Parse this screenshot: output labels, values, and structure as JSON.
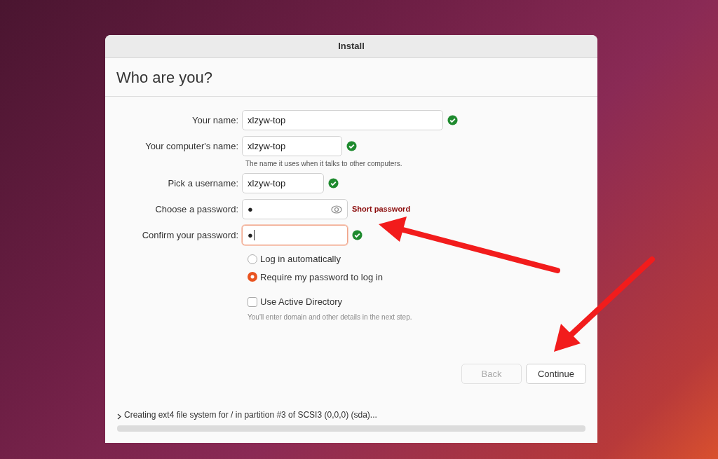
{
  "window": {
    "title": "Install"
  },
  "heading": "Who are you?",
  "fields": [
    {
      "label": "Your name:",
      "value": "xlzyw-top",
      "valid": true,
      "focused": false
    },
    {
      "label": "Your computer's name:",
      "value": "xlzyw-top",
      "valid": true,
      "focused": false,
      "hint": "The name it uses when it talks to other computers."
    },
    {
      "label": "Pick a username:",
      "value": "xlzyw-top",
      "valid": true,
      "focused": false
    },
    {
      "label": "Choose a password:",
      "value": "●",
      "valid": false,
      "focused": false,
      "reveal_icon": true,
      "message": "Short password"
    },
    {
      "label": "Confirm your password:",
      "value": "●",
      "valid": true,
      "focused": true
    }
  ],
  "login_options": [
    {
      "label": "Log in automatically",
      "selected": false
    },
    {
      "label": "Require my password to log in",
      "selected": true
    }
  ],
  "active_directory": {
    "label": "Use Active Directory",
    "checked": false,
    "hint": "You'll enter domain and other details in the next step."
  },
  "buttons": [
    {
      "label": "Back",
      "disabled": true
    },
    {
      "label": "Continue",
      "disabled": false
    }
  ],
  "progress": {
    "text": "Creating ext4 file system for / in partition #3 of SCSI3 (0,0,0) (sda)...",
    "level": 0
  }
}
